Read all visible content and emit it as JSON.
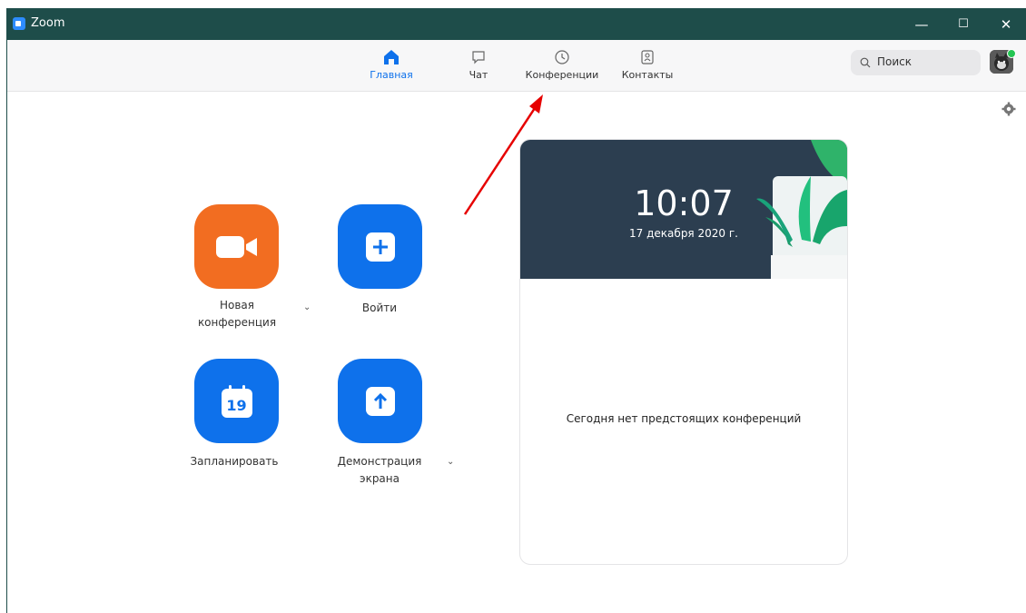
{
  "window": {
    "title": "Zoom",
    "minimize": "—",
    "maximize": "☐",
    "close": "✕"
  },
  "nav": [
    {
      "label": "Главная",
      "icon": "home-icon",
      "active": true
    },
    {
      "label": "Чат",
      "icon": "chat-icon",
      "active": false
    },
    {
      "label": "Конференции",
      "icon": "clock-icon",
      "active": false
    },
    {
      "label": "Контакты",
      "icon": "contacts-icon",
      "active": false
    }
  ],
  "search": {
    "placeholder": "Поиск"
  },
  "actions": {
    "new_meeting": "Новая\nконференция",
    "join": "Войти",
    "schedule": "Запланировать",
    "schedule_day": "19",
    "share_screen": "Демонстрация\nэкрана",
    "chevron": "⌄"
  },
  "panel": {
    "time": "10:07",
    "date": "17 декабря 2020 г.",
    "empty_message": "Сегодня нет предстоящих конференций"
  },
  "colors": {
    "titlebar": "#1e4d4a",
    "accent": "#0e71eb",
    "orange": "#f26d21",
    "annotation_arrow": "#e60000"
  }
}
